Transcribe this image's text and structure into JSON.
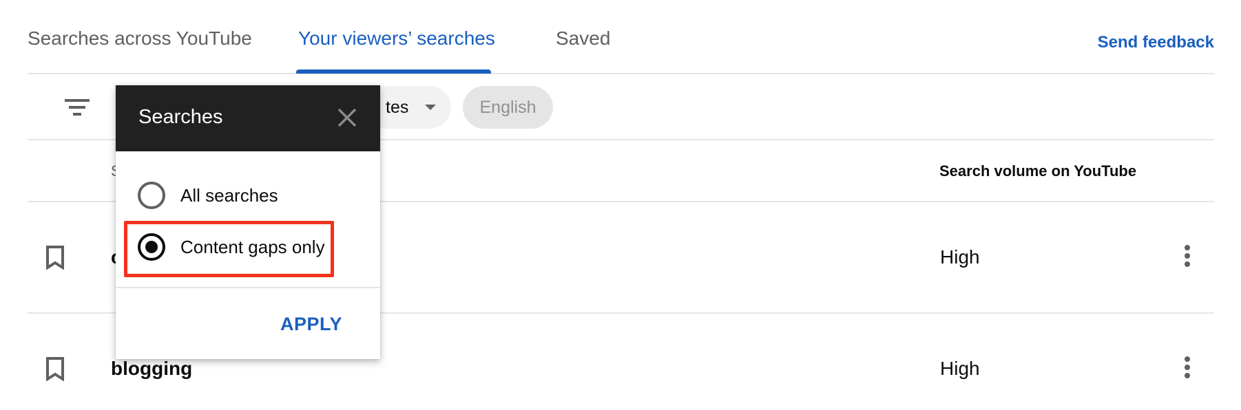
{
  "tabs": [
    {
      "label": "Searches across YouTube",
      "active": false
    },
    {
      "label": "Your viewers’ searches",
      "active": true
    },
    {
      "label": "Saved",
      "active": false
    }
  ],
  "header": {
    "feedback_label": "Send feedback"
  },
  "filters": {
    "filter_icon": "filter-list-icon",
    "location_chip_label": "tes",
    "language_chip_label": "English"
  },
  "columns": {
    "search": "S",
    "volume": "Search volume on YouTube"
  },
  "rows": [
    {
      "term": "c",
      "volume": "High",
      "bookmark_icon": "bookmark-outline-icon",
      "menu_icon": "more-vert-icon"
    },
    {
      "term": "blogging",
      "volume": "High",
      "bookmark_icon": "bookmark-outline-icon",
      "menu_icon": "more-vert-icon"
    }
  ],
  "popup": {
    "title": "Searches",
    "close_icon": "close-icon",
    "options": [
      {
        "label": "All searches",
        "selected": false
      },
      {
        "label": "Content gaps only",
        "selected": true
      }
    ],
    "apply_label": "APPLY"
  },
  "colors": {
    "accent": "#1a5fc0",
    "highlight": "#f0331c",
    "popup_header": "#212121"
  }
}
